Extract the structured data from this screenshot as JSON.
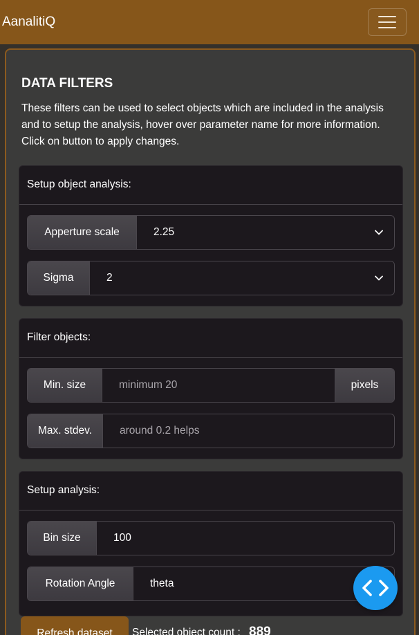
{
  "navbar": {
    "brand": "AanalitiQ",
    "toggle_icon": "hamburger-menu-icon"
  },
  "filters": {
    "title": "DATA FILTERS",
    "description": "These filters can be used to select objects which are included in the analysis and to setup the analysis, hover over parameter name for more information. Click on button to apply changes."
  },
  "setup_object_analysis": {
    "header": "Setup object analysis:",
    "aperture": {
      "label": "Apperture scale",
      "value": "2.25"
    },
    "sigma": {
      "label": "Sigma",
      "value": "2"
    }
  },
  "filter_objects": {
    "header": "Filter objects:",
    "min_size": {
      "label": "Min. size",
      "placeholder": "minimum 20",
      "suffix": "pixels"
    },
    "max_stdev": {
      "label": "Max. stdev.",
      "placeholder": "around 0.2 helps"
    }
  },
  "setup_analysis": {
    "header": "Setup analysis:",
    "bin_size": {
      "label": "Bin size",
      "value": "100"
    },
    "rotation_angle": {
      "label": "Rotation Angle",
      "value": "theta"
    }
  },
  "actions": {
    "refresh_label": "Refresh dataset",
    "count_label": "Selected object count :",
    "count_value": "889",
    "code_icon": "code-brackets-icon"
  },
  "colors": {
    "navbar": "#86561a",
    "panel_border": "#8c5a1e",
    "card_bg": "#1c181d",
    "fab": "#1b9af0"
  }
}
